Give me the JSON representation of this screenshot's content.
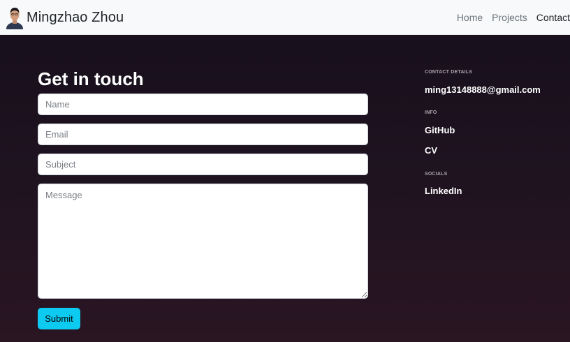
{
  "navbar": {
    "brand_name": "Mingzhao Zhou",
    "avatar_icon": "person-avatar-icon",
    "links": [
      {
        "label": "Home",
        "active": false
      },
      {
        "label": "Projects",
        "active": false
      },
      {
        "label": "Contact",
        "active": true
      }
    ]
  },
  "contact_form": {
    "heading": "Get in touch",
    "name_placeholder": "Name",
    "email_placeholder": "Email",
    "subject_placeholder": "Subject",
    "message_placeholder": "Message",
    "submit_label": "Submit"
  },
  "sidebar": {
    "contact_details": {
      "label": "CONTACT DETAILS",
      "email": "ming13148888@gmail.com"
    },
    "info": {
      "label": "INFO",
      "github": "GitHub",
      "cv": "CV"
    },
    "socials": {
      "label": "SOCIALS",
      "linkedin": "LinkedIn"
    }
  },
  "colors": {
    "navbar_bg": "#f8f9fa",
    "page_bg": "#1f1320",
    "submit_button": "#0dcaf0"
  }
}
